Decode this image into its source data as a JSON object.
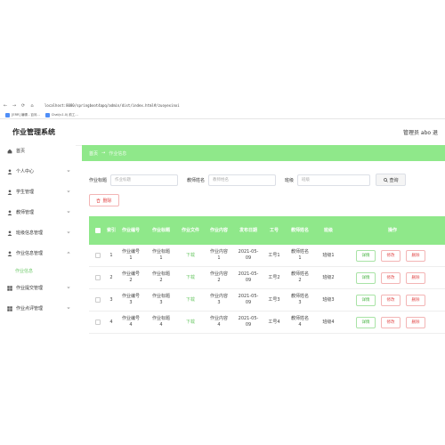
{
  "browser": {
    "nav": [
      "←",
      "→",
      "⟳",
      "⌂"
    ],
    "url": "localhost:8080/springboot4apq/admin/dist/index.html#/zuoyexinxi",
    "bookmarks": [
      "[ERR] 编辑 - 百问...",
      "Chat(v1.0) 前工..."
    ]
  },
  "header": {
    "title": "作业管理系统",
    "admin": "管理员 abo   退"
  },
  "sidebar": {
    "items": [
      {
        "label": "首页",
        "icon": "home-icon"
      },
      {
        "label": "个人中心",
        "icon": "user-icon"
      },
      {
        "label": "学生管理",
        "icon": "user-icon"
      },
      {
        "label": "教师管理",
        "icon": "user-icon"
      },
      {
        "label": "班级信息管理",
        "icon": "user-icon"
      },
      {
        "label": "作业信息管理",
        "icon": "user-icon"
      }
    ],
    "sub_item": "作业信息",
    "items_after": [
      {
        "label": "作业提交管理",
        "icon": "grid-icon"
      },
      {
        "label": "作业点评管理",
        "icon": "grid-icon"
      }
    ]
  },
  "breadcrumb": {
    "home": "首页",
    "sep": "→",
    "current": "作业信息"
  },
  "search": {
    "title_label": "作业标题",
    "title_placeholder": "作业标题",
    "teacher_label": "教师姓名",
    "teacher_placeholder": "教师姓名",
    "class_label": "班级",
    "class_placeholder": "班级",
    "query_button": "查询"
  },
  "delete_button": "删除",
  "table": {
    "headers": [
      "索引",
      "作业编号",
      "作业标题",
      "作业文件",
      "作业内容",
      "发布日期",
      "工号",
      "教师姓名",
      "班级",
      "操作"
    ],
    "rows": [
      {
        "index": "1",
        "no": "作业编号\n1",
        "title": "作业标题\n1",
        "file": "下载",
        "content": "作业内容\n1",
        "date": "2021-05-\n09",
        "job_no": "工号1",
        "teacher": "教师姓名\n1",
        "class": "班级1"
      },
      {
        "index": "2",
        "no": "作业编号\n2",
        "title": "作业标题\n2",
        "file": "下载",
        "content": "作业内容\n2",
        "date": "2021-05-\n09",
        "job_no": "工号2",
        "teacher": "教师姓名\n2",
        "class": "班级2"
      },
      {
        "index": "3",
        "no": "作业编号\n3",
        "title": "作业标题\n3",
        "file": "下载",
        "content": "作业内容\n3",
        "date": "2021-05-\n09",
        "job_no": "工号3",
        "teacher": "教师姓名\n3",
        "class": "班级3"
      },
      {
        "index": "4",
        "no": "作业编号\n4",
        "title": "作业标题\n4",
        "file": "下载",
        "content": "作业内容\n4",
        "date": "2021-05-\n09",
        "job_no": "工号4",
        "teacher": "教师姓名\n4",
        "class": "班级4"
      }
    ],
    "actions": {
      "detail": "详情",
      "edit": "修改",
      "delete": "删除"
    }
  },
  "colors": {
    "accent": "#8fe88a",
    "accent_text": "#6fc96a",
    "danger": "#e24b4b"
  }
}
